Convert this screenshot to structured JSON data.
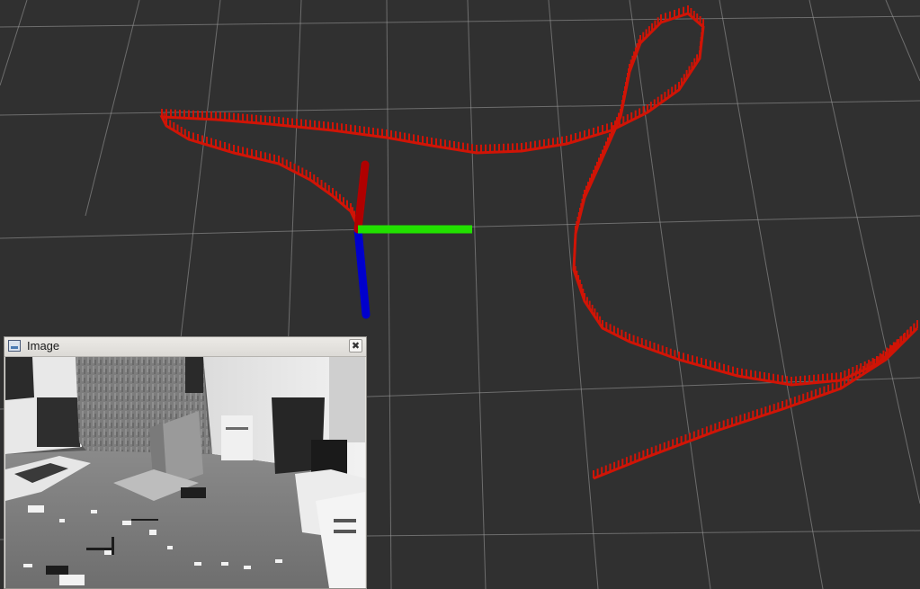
{
  "image_window": {
    "title": "Image",
    "close_glyph": "✖",
    "icons": {
      "window": "image-icon",
      "close": "close-icon"
    }
  },
  "scene": {
    "background_color": "#303030",
    "grid_color": "#a0a0a0",
    "trajectory_color": "#d01406",
    "axis_colors": {
      "x": "#b00000",
      "y": "#22e000",
      "z": "#0000cc"
    }
  }
}
